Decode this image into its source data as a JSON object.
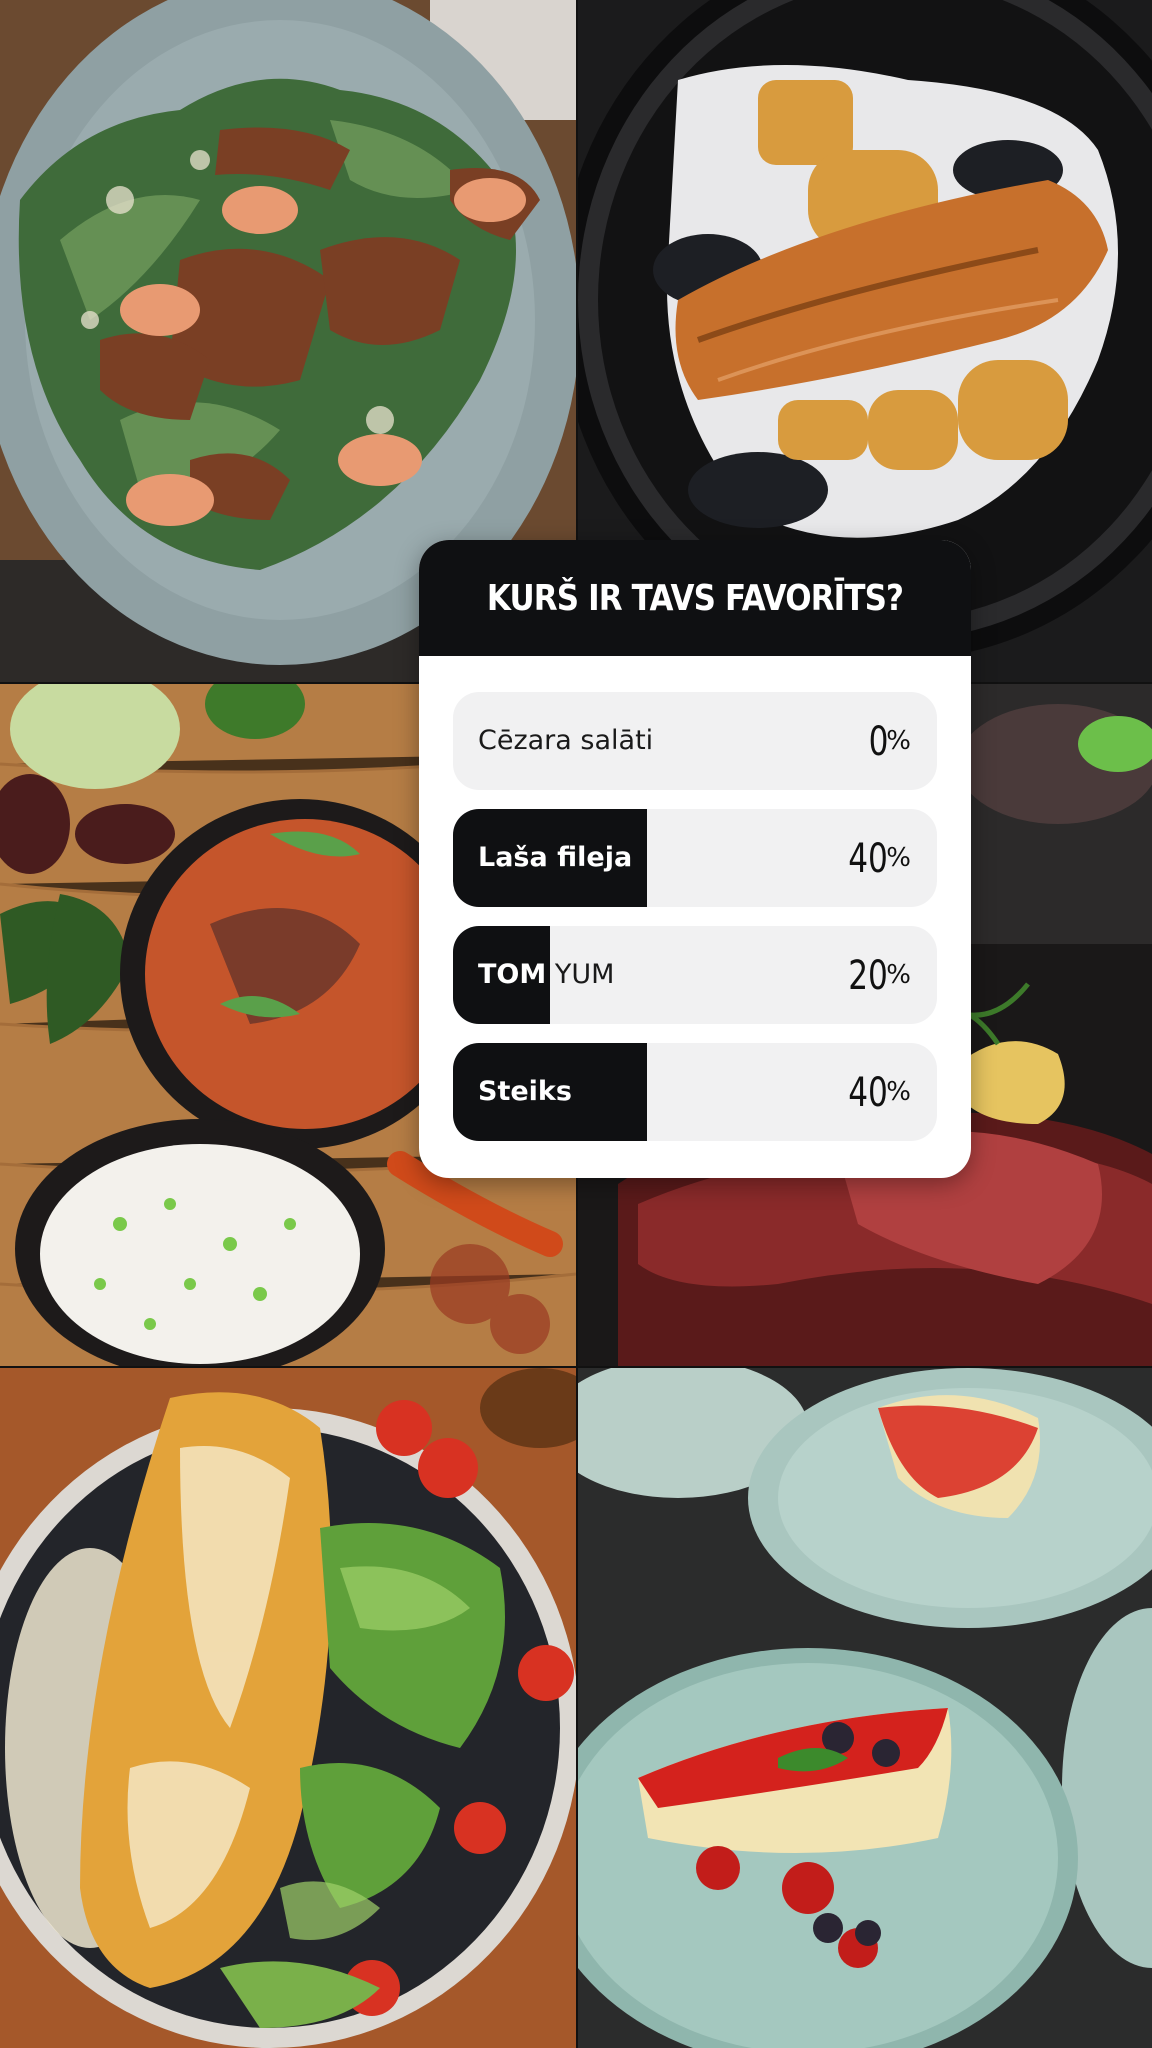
{
  "poll": {
    "question": "KURŠ IR TAVS FAVORĪTS?",
    "options": [
      {
        "label": "Cēzara salāti",
        "percent": "0",
        "value": 0
      },
      {
        "label": "Laša fileja",
        "percent": "40",
        "value": 40
      },
      {
        "label": "TOM YUM",
        "percent": "20",
        "value": 20
      },
      {
        "label": "Steiks",
        "percent": "40",
        "value": 40
      }
    ],
    "percent_sign": "%"
  },
  "colors": {
    "header_bg": "#0f1012",
    "option_bg": "#f1f1f2",
    "fill": "#0f1012",
    "card_bg": "#ffffff"
  },
  "photos": {
    "top_left": "caesar-salad-photo",
    "top_right": "salmon-fillet-photo",
    "middle_left": "tom-yum-soup-photo",
    "middle_right": "steak-photo",
    "bottom_left": "omelette-salad-photo",
    "bottom_right": "cheesecake-photo"
  }
}
